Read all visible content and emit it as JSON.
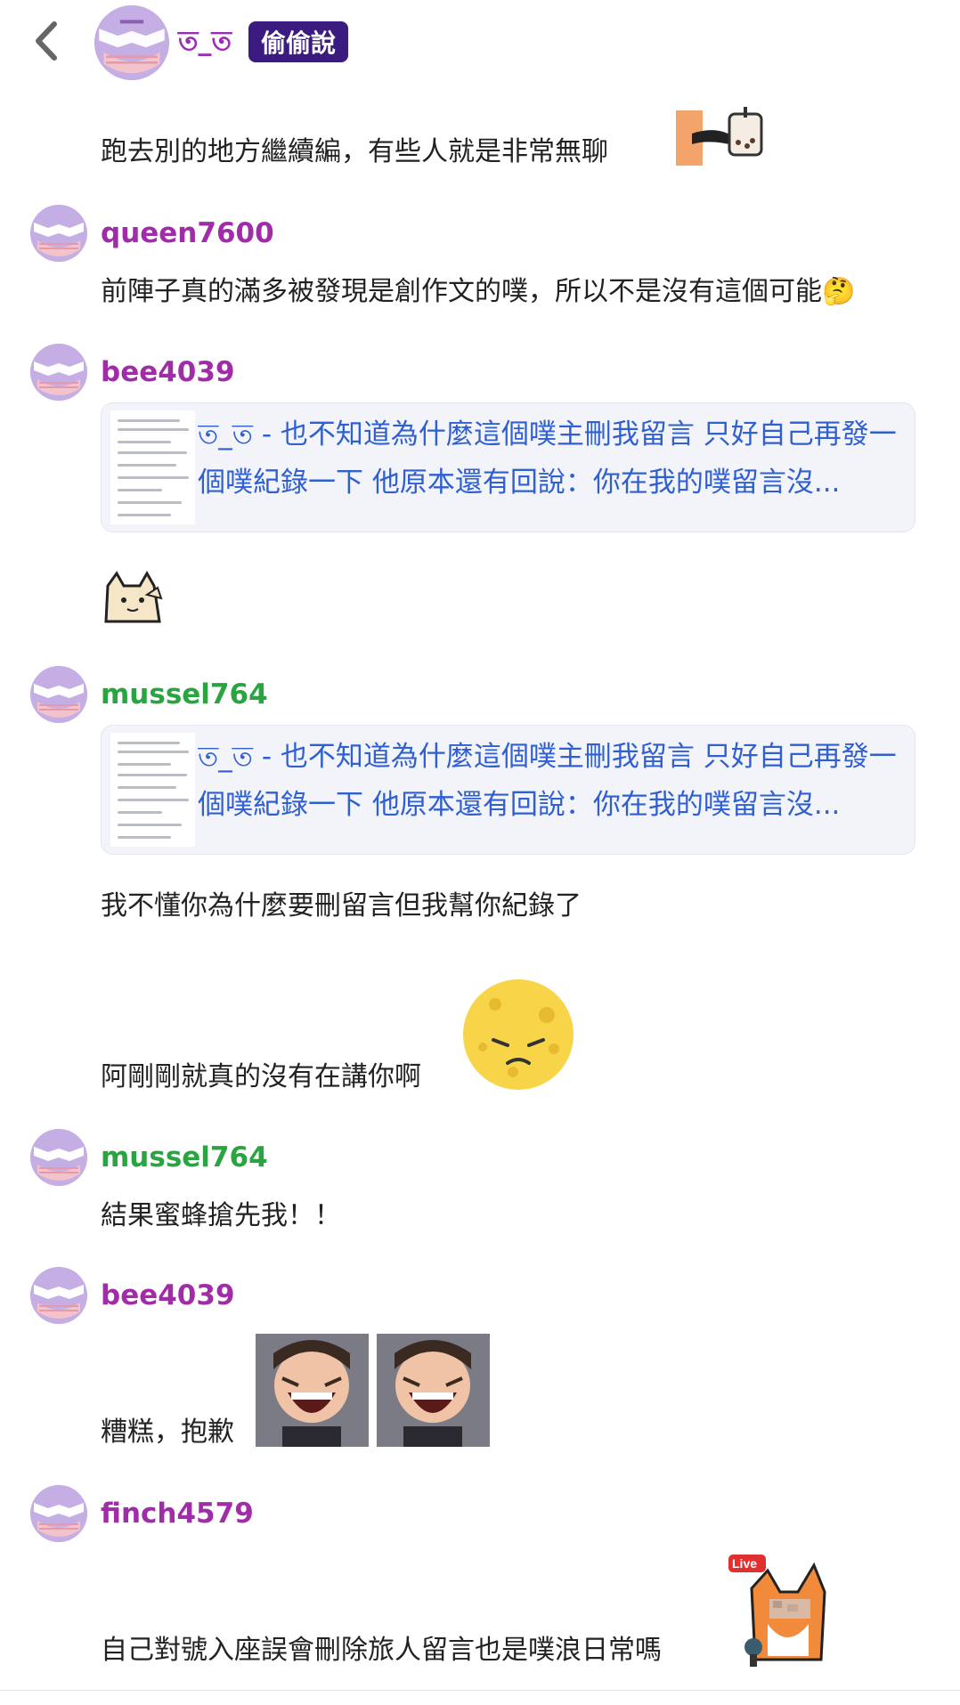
{
  "header": {
    "back_icon": "chevron-left-icon",
    "name": "ত_ত",
    "badge": "偷偷說"
  },
  "posts": [
    {
      "text": "跑去別的地方繼續編，有些人就是非常無聊"
    },
    {
      "user": "queen7600",
      "text": "前陣子真的滿多被發現是創作文的噗，所以不是沒有這個可能🤔"
    },
    {
      "user": "bee4039",
      "card_title": "ত_ত - 也不知道為什麼這個噗主刪我留言 只好自己再發一個噗紀錄一下 他原本還有回說：你在我的噗留言沒..."
    },
    {
      "user": "mussel764",
      "card_title": "ত_ত - 也不知道為什麼這個噗主刪我留言 只好自己再發一個噗紀錄一下 他原本還有回說：你在我的噗留言沒...",
      "text": "我不懂你為什麼要刪留言但我幫你紀錄了",
      "text2": "阿剛剛就真的沒有在講你啊"
    },
    {
      "user": "mussel764",
      "text": "結果蜜蜂搶先我！！"
    },
    {
      "user": "bee4039",
      "text": "糟糕，抱歉"
    },
    {
      "user": "finch4579",
      "text": "自己對號入座誤會刪除旅人留言也是噗浪日常嗎",
      "sticker_label": "Live"
    }
  ],
  "colors": {
    "name_purple": "#a02ca8",
    "name_green": "#2aa441",
    "badge_bg": "#3b1b80",
    "link_blue": "#2f5fd1",
    "avatar_bg": "#c4aee4"
  }
}
